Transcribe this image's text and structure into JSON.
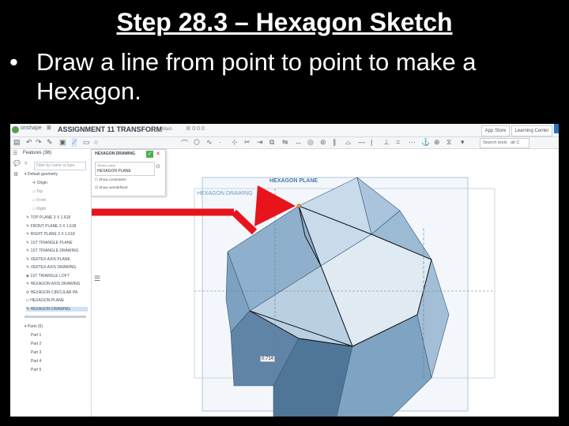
{
  "slide": {
    "title": "Step 28.3 – Hexagon Sketch",
    "bullet": "•",
    "bullet_text": "Draw a line from point to point to make a Hexagon."
  },
  "app": {
    "logo_text": "onshape",
    "doc_title": "ASSIGNMENT 11 TRANSFORM",
    "branch": "Main",
    "top_counts": "0   0   0",
    "app_store": "App Store",
    "learning_center": "Learning Center",
    "search_tools": "Search tools",
    "search_shortcut": "alt C"
  },
  "features": {
    "header": "Features (38)",
    "filter_placeholder": "Filter by name or type",
    "default_geometry": "Default geometry",
    "origin": "Origin",
    "top": "Top",
    "front": "Front",
    "right": "Right",
    "items": [
      "TOP PLANE 3 X 1.618",
      "FRONT PLANE 3 X 1.618",
      "RIGHT PLANE 3 X 1.618",
      "1ST TRIANGLE PLANE",
      "1ST TRIANGLE DRAWING",
      "VERTEX AXIS PLANE",
      "VERTEX AXIS DRAWING",
      "1ST TRIANGLE LOFT",
      "HEXAGON AXIS DRAWING",
      "HEXAGON CIRCULAR PA",
      "HEXAGON PLANE",
      "HEXAGON DRAWING"
    ],
    "parts_header": "Parts (6)",
    "parts": [
      "Part 1",
      "Part 2",
      "Part 3",
      "Part 4",
      "Part 5"
    ]
  },
  "dialog": {
    "title": "HEXAGON DRAWING",
    "sketch_plane_label": "Sketch plane",
    "sketch_plane_value": "HEXAGON PLANE",
    "show_constraints": "Show constraints",
    "show_overdefined": "Show overdefined"
  },
  "viewport": {
    "plane_label": "HEXAGON PLANE",
    "drawing_label": "HEXAGON DRAWING",
    "dimension": "0.714"
  },
  "colors": {
    "arrow": "#e8141b",
    "face_light": "#b9d0e3",
    "face_mid": "#8fb0cc",
    "face_dark": "#5f84a6",
    "accent": "#2a72c0"
  }
}
